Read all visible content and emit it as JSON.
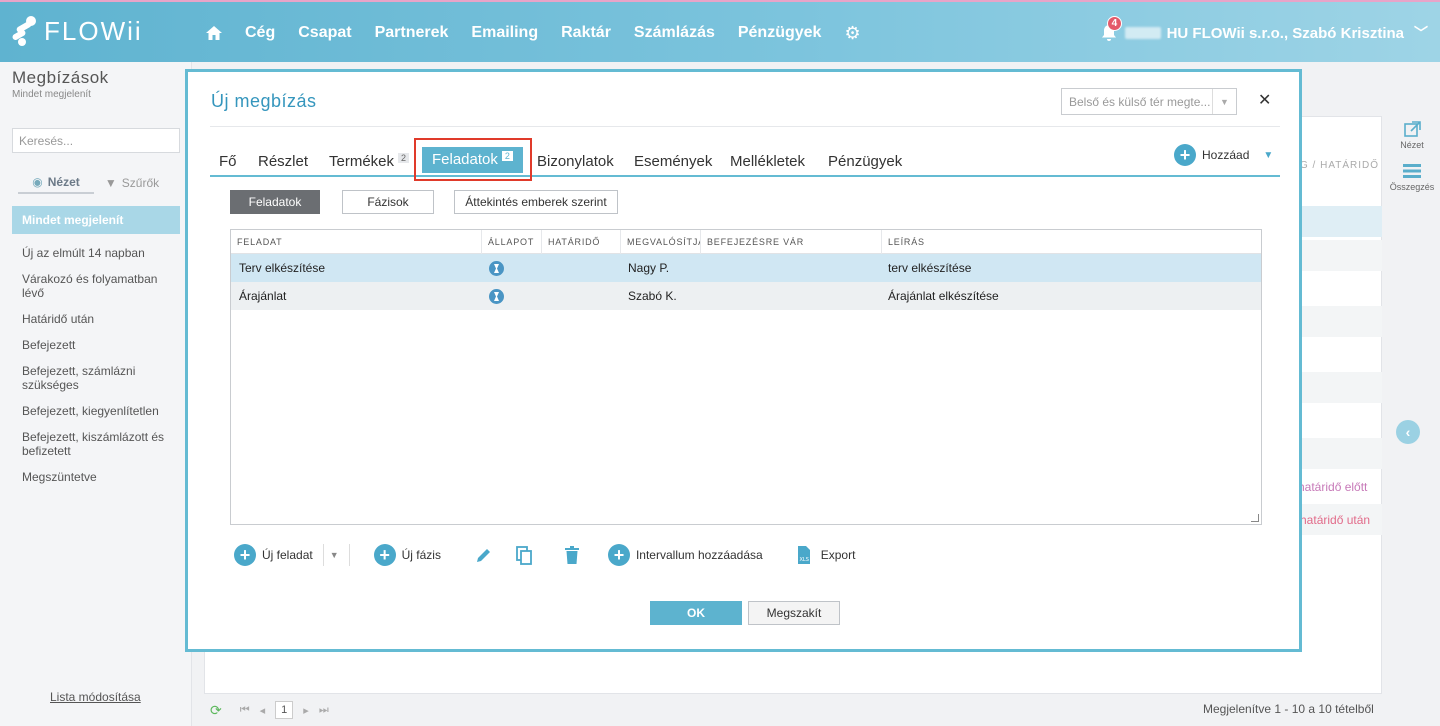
{
  "app": {
    "logo": "FLOWii"
  },
  "nav": {
    "items": [
      "Cég",
      "Csapat",
      "Partnerek",
      "Emailing",
      "Raktár",
      "Számlázás",
      "Pénzügyek"
    ]
  },
  "user": {
    "notifications": "4",
    "name": "HU FLOWii s.r.o., Szabó Krisztina"
  },
  "sidebar": {
    "title": "Megbízások",
    "subtitle": "Mindet megjelenít",
    "search_placeholder": "Keresés...",
    "tabs": [
      "Nézet",
      "Szűrők"
    ],
    "items": [
      "Mindet megjelenít",
      "Új az elmúlt 14 napban",
      "Várakozó és folyamatban lévő",
      "Határidő után",
      "Befejezett",
      "Befejezett, számlázni szükséges",
      "Befejezett, kiegyenlítetlen",
      "Befejezett, kiszámlázott és befizetett",
      "Megszüntetve"
    ],
    "footer": "Lista módosítása"
  },
  "background": {
    "header_fragment": "G / HATÁRIDŐ",
    "notes": [
      "határidő előtt",
      "a határidő után"
    ],
    "right_tools": [
      "Nézet",
      "Összegzés"
    ],
    "pager_page": "1",
    "pager_info": "Megjelenítve 1 - 10 a 10 tételből"
  },
  "modal": {
    "title": "Új megbízás",
    "select_value": "Belső és külső tér megte...",
    "tabs": [
      {
        "label": "Fő",
        "count": ""
      },
      {
        "label": "Részlet",
        "count": ""
      },
      {
        "label": "Termékek",
        "count": "2"
      },
      {
        "label": "Feladatok",
        "count": "2"
      },
      {
        "label": "Bizonylatok",
        "count": ""
      },
      {
        "label": "Események",
        "count": ""
      },
      {
        "label": "Mellékletek",
        "count": ""
      },
      {
        "label": "Pénzügyek",
        "count": ""
      }
    ],
    "add_label": "Hozzáad",
    "segments": [
      "Feladatok",
      "Fázisok",
      "Áttekintés emberek szerint"
    ],
    "columns": [
      "FELADAT",
      "ÁLLAPOT",
      "HATÁRIDŐ",
      "MEGVALÓSÍTJA",
      "BEFEJEZÉSRE VÁR",
      "LEÍRÁS"
    ],
    "rows": [
      {
        "task": "Terv elkészítése",
        "status": "waiting",
        "deadline": "",
        "owner": "Nagy P.",
        "waits": "",
        "desc": "terv elkészítése"
      },
      {
        "task": "Árajánlat",
        "status": "waiting",
        "deadline": "",
        "owner": "Szabó K.",
        "waits": "",
        "desc": "Árajánlat elkészítése"
      }
    ],
    "toolbar": {
      "new_task": "Új feladat",
      "new_phase": "Új fázis",
      "add_interval": "Intervallum hozzáadása",
      "export": "Export"
    },
    "ok": "OK",
    "cancel": "Megszakít"
  }
}
